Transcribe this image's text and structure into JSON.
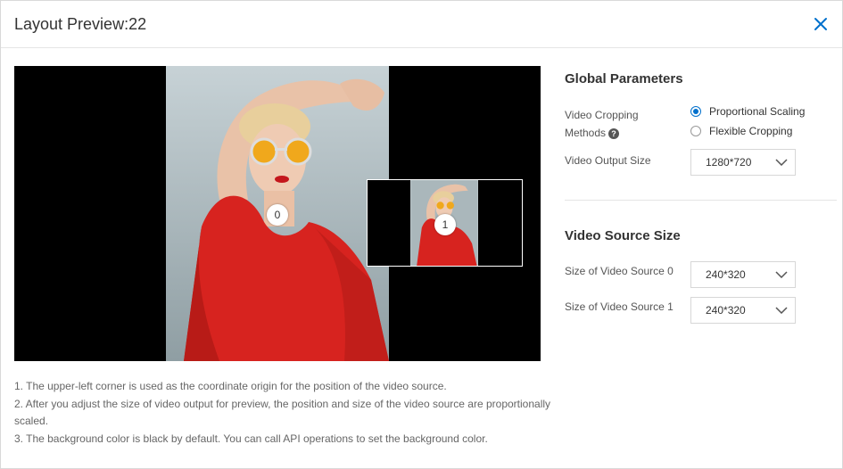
{
  "dialog": {
    "title": "Layout Preview:22",
    "close_icon": "close-icon"
  },
  "preview": {
    "sources": [
      {
        "index_label": "0"
      },
      {
        "index_label": "1"
      }
    ],
    "background_color": "#000000"
  },
  "notes": [
    "1. The upper-left corner is used as the coordinate origin for the position of the video source.",
    "2. After you adjust the size of video output for preview, the position and size of the video source are proportionally scaled.",
    "3. The background color is black by default. You can call API operations to set the background color."
  ],
  "global_parameters": {
    "title": "Global Parameters",
    "cropping_label_line1": "Video Cropping",
    "cropping_label_line2": "Methods",
    "help_icon": "question-circle-icon",
    "help_glyph": "?",
    "options": [
      {
        "label": "Proportional Scaling",
        "selected": true
      },
      {
        "label": "Flexible Cropping",
        "selected": false
      }
    ],
    "output_size_label": "Video Output Size",
    "output_size_value": "1280*720"
  },
  "video_source_size": {
    "title": "Video Source Size",
    "sources": [
      {
        "label": "Size of Video Source 0",
        "value": "240*320"
      },
      {
        "label": "Size of Video Source 1",
        "value": "240*320"
      }
    ]
  },
  "colors": {
    "accent": "#0070cc",
    "dress": "#d7231f"
  }
}
